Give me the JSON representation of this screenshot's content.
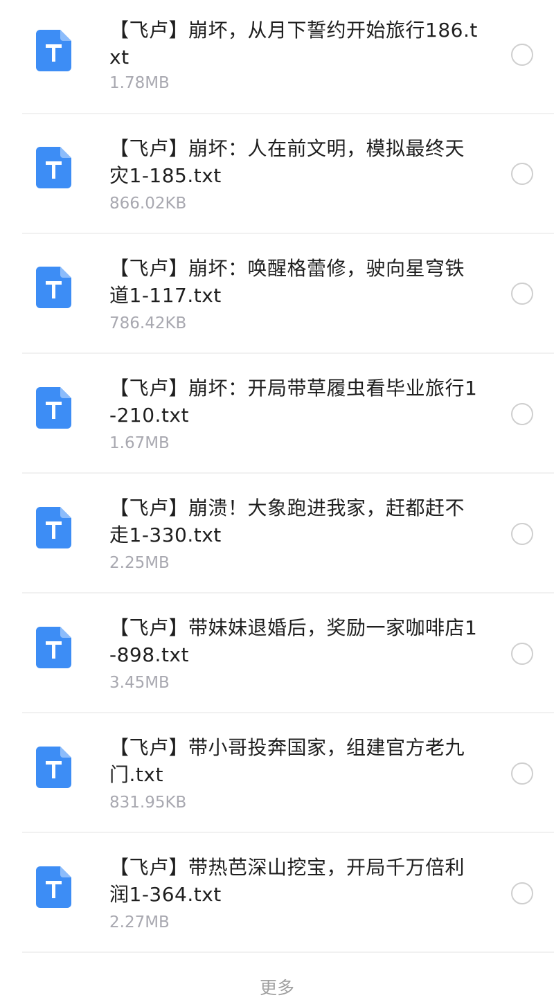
{
  "files": [
    {
      "name": "【飞卢】崩坏，从月下誓约开始旅行186.txt",
      "size": "1.78MB",
      "icon": "txt-file-icon",
      "selected": false
    },
    {
      "name": "【飞卢】崩坏：人在前文明，模拟最终天灾1-185.txt",
      "size": "866.02KB",
      "icon": "txt-file-icon",
      "selected": false
    },
    {
      "name": "【飞卢】崩坏：唤醒格蕾修，驶向星穹铁道1-117.txt",
      "size": "786.42KB",
      "icon": "txt-file-icon",
      "selected": false
    },
    {
      "name": "【飞卢】崩坏：开局带草履虫看毕业旅行1-210.txt",
      "size": "1.67MB",
      "icon": "txt-file-icon",
      "selected": false
    },
    {
      "name": "【飞卢】崩溃！大象跑进我家，赶都赶不走1-330.txt",
      "size": "2.25MB",
      "icon": "txt-file-icon",
      "selected": false
    },
    {
      "name": "【飞卢】带妹妹退婚后，奖励一家咖啡店1-898.txt",
      "size": "3.45MB",
      "icon": "txt-file-icon",
      "selected": false
    },
    {
      "name": "【飞卢】带小哥投奔国家，组建官方老九门.txt",
      "size": "831.95KB",
      "icon": "txt-file-icon",
      "selected": false
    },
    {
      "name": "【飞卢】带热芭深山挖宝，开局千万倍利润1-364.txt",
      "size": "2.27MB",
      "icon": "txt-file-icon",
      "selected": false
    }
  ],
  "more_label": "更多",
  "colors": {
    "icon_blue": "#3d8df5",
    "icon_fold": "#8cbcfb",
    "name_text": "#1f1f1f",
    "size_text": "#a8a8b0",
    "radio_border": "#cfcfcf"
  }
}
